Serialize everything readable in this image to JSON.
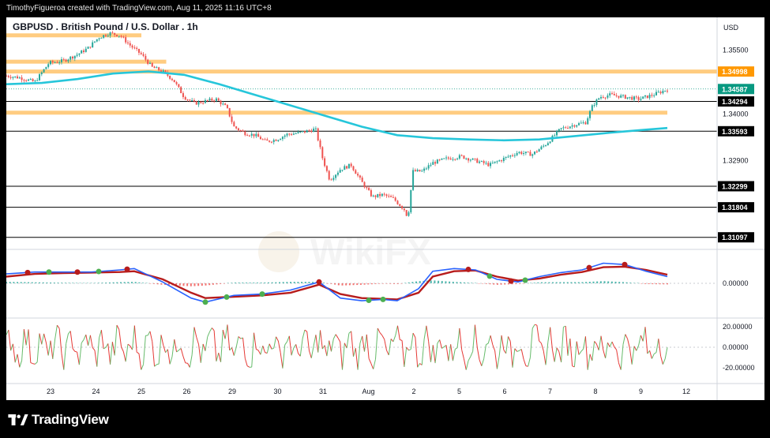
{
  "header": {
    "byline": "TimothyFigueroa created with TradingView.com, Aug 11, 2025 11:16 UTC+8"
  },
  "footer": {
    "brand": "TradingView"
  },
  "watermark": {
    "text": "WikiFX"
  },
  "colors": {
    "up": "#26a69a",
    "down": "#ef5350",
    "ema": "#26c6da",
    "zone": "#ffcc80",
    "resistance_tag": "#ff9800",
    "price_tag": "#089981",
    "level_tag": "#000000",
    "macd_fast": "#2962ff",
    "macd_slow": "#b71c1c",
    "macd_signal_green": "#4caf50",
    "osc_up": "#66bb6a",
    "osc_down": "#e53935"
  },
  "chart_data": {
    "type": "candlestick",
    "title": "GBPUSD . British Pound / U.S. Dollar . 1h",
    "currency": "USD",
    "x_labels": [
      "23",
      "24",
      "25",
      "26",
      "29",
      "30",
      "31",
      "Aug",
      "2",
      "5",
      "6",
      "7",
      "8",
      "9",
      "12"
    ],
    "y_ticks": [
      "1.35500",
      "1.34000",
      "1.32900"
    ],
    "ylim": [
      1.3085,
      1.3605
    ],
    "price_tags": [
      {
        "label": "1.34998",
        "value": 1.34998,
        "style": "resistance"
      },
      {
        "label": "1.34587",
        "value": 1.34587,
        "style": "current"
      },
      {
        "label": "1.34294",
        "value": 1.34294,
        "style": "level"
      },
      {
        "label": "1.33593",
        "value": 1.33593,
        "style": "level"
      },
      {
        "label": "1.32299",
        "value": 1.32299,
        "style": "level"
      },
      {
        "label": "1.31804",
        "value": 1.31804,
        "style": "level"
      },
      {
        "label": "1.31097",
        "value": 1.31097,
        "style": "level"
      }
    ],
    "zones": [
      {
        "value": 1.3585,
        "x_start": 0.0,
        "x_end": 0.19
      },
      {
        "value": 1.3523,
        "x_start": 0.0,
        "x_end": 0.225
      },
      {
        "value": 1.34998,
        "x_start": 0.0,
        "x_end": 1.0
      },
      {
        "value": 1.3403,
        "x_start": 0.0,
        "x_end": 0.93
      }
    ],
    "price_path": [
      [
        0.0,
        1.349
      ],
      [
        0.02,
        1.3485
      ],
      [
        0.04,
        1.3475
      ],
      [
        0.06,
        1.352
      ],
      [
        0.08,
        1.3525
      ],
      [
        0.1,
        1.354
      ],
      [
        0.115,
        1.3555
      ],
      [
        0.13,
        1.358
      ],
      [
        0.145,
        1.359
      ],
      [
        0.16,
        1.3585
      ],
      [
        0.175,
        1.356
      ],
      [
        0.19,
        1.354
      ],
      [
        0.205,
        1.351
      ],
      [
        0.22,
        1.35
      ],
      [
        0.235,
        1.348
      ],
      [
        0.25,
        1.344
      ],
      [
        0.265,
        1.3425
      ],
      [
        0.28,
        1.343
      ],
      [
        0.295,
        1.3435
      ],
      [
        0.31,
        1.3415
      ],
      [
        0.32,
        1.337
      ],
      [
        0.335,
        1.3355
      ],
      [
        0.35,
        1.335
      ],
      [
        0.365,
        1.3335
      ],
      [
        0.38,
        1.334
      ],
      [
        0.395,
        1.3352
      ],
      [
        0.41,
        1.3355
      ],
      [
        0.425,
        1.336
      ],
      [
        0.435,
        1.3365
      ],
      [
        0.445,
        1.3295
      ],
      [
        0.455,
        1.3245
      ],
      [
        0.47,
        1.327
      ],
      [
        0.485,
        1.328
      ],
      [
        0.5,
        1.324
      ],
      [
        0.515,
        1.3205
      ],
      [
        0.53,
        1.321
      ],
      [
        0.545,
        1.32
      ],
      [
        0.56,
        1.3175
      ],
      [
        0.565,
        1.3155
      ],
      [
        0.572,
        1.3265
      ],
      [
        0.585,
        1.3265
      ],
      [
        0.6,
        1.3285
      ],
      [
        0.62,
        1.3295
      ],
      [
        0.64,
        1.33
      ],
      [
        0.66,
        1.329
      ],
      [
        0.68,
        1.328
      ],
      [
        0.7,
        1.3295
      ],
      [
        0.72,
        1.331
      ],
      [
        0.74,
        1.3305
      ],
      [
        0.76,
        1.333
      ],
      [
        0.78,
        1.3365
      ],
      [
        0.8,
        1.3375
      ],
      [
        0.815,
        1.338
      ],
      [
        0.825,
        1.342
      ],
      [
        0.835,
        1.344
      ],
      [
        0.85,
        1.3445
      ],
      [
        0.87,
        1.344
      ],
      [
        0.89,
        1.3435
      ],
      [
        0.91,
        1.3445
      ],
      [
        0.93,
        1.3458
      ]
    ],
    "ema_path": [
      [
        0.0,
        1.347
      ],
      [
        0.05,
        1.3473
      ],
      [
        0.1,
        1.3482
      ],
      [
        0.15,
        1.3495
      ],
      [
        0.2,
        1.35
      ],
      [
        0.25,
        1.3492
      ],
      [
        0.3,
        1.347
      ],
      [
        0.35,
        1.3445
      ],
      [
        0.4,
        1.342
      ],
      [
        0.45,
        1.3395
      ],
      [
        0.5,
        1.337
      ],
      [
        0.55,
        1.335
      ],
      [
        0.6,
        1.3343
      ],
      [
        0.65,
        1.334
      ],
      [
        0.7,
        1.3338
      ],
      [
        0.75,
        1.334
      ],
      [
        0.8,
        1.3348
      ],
      [
        0.85,
        1.3356
      ],
      [
        0.9,
        1.3363
      ],
      [
        0.93,
        1.3367
      ]
    ],
    "macd": {
      "zero_label": "0.00000",
      "fast": [
        [
          0.0,
          0.35
        ],
        [
          0.04,
          0.42
        ],
        [
          0.08,
          0.42
        ],
        [
          0.12,
          0.42
        ],
        [
          0.16,
          0.5
        ],
        [
          0.18,
          0.55
        ],
        [
          0.22,
          0.05
        ],
        [
          0.26,
          -0.55
        ],
        [
          0.28,
          -0.7
        ],
        [
          0.32,
          -0.45
        ],
        [
          0.36,
          -0.4
        ],
        [
          0.4,
          -0.25
        ],
        [
          0.44,
          0.05
        ],
        [
          0.47,
          -0.55
        ],
        [
          0.5,
          -0.65
        ],
        [
          0.53,
          -0.6
        ],
        [
          0.55,
          -0.65
        ],
        [
          0.58,
          -0.2
        ],
        [
          0.6,
          0.45
        ],
        [
          0.63,
          0.55
        ],
        [
          0.66,
          0.5
        ],
        [
          0.69,
          0.15
        ],
        [
          0.72,
          0.05
        ],
        [
          0.75,
          0.25
        ],
        [
          0.78,
          0.4
        ],
        [
          0.81,
          0.5
        ],
        [
          0.84,
          0.75
        ],
        [
          0.87,
          0.7
        ],
        [
          0.9,
          0.45
        ],
        [
          0.93,
          0.25
        ]
      ],
      "slow": [
        [
          0.0,
          0.25
        ],
        [
          0.04,
          0.35
        ],
        [
          0.08,
          0.38
        ],
        [
          0.12,
          0.4
        ],
        [
          0.16,
          0.42
        ],
        [
          0.18,
          0.45
        ],
        [
          0.22,
          0.15
        ],
        [
          0.26,
          -0.35
        ],
        [
          0.28,
          -0.55
        ],
        [
          0.32,
          -0.5
        ],
        [
          0.36,
          -0.45
        ],
        [
          0.4,
          -0.35
        ],
        [
          0.44,
          -0.05
        ],
        [
          0.47,
          -0.4
        ],
        [
          0.5,
          -0.55
        ],
        [
          0.53,
          -0.58
        ],
        [
          0.55,
          -0.6
        ],
        [
          0.58,
          -0.35
        ],
        [
          0.6,
          0.25
        ],
        [
          0.63,
          0.45
        ],
        [
          0.66,
          0.48
        ],
        [
          0.69,
          0.25
        ],
        [
          0.72,
          0.1
        ],
        [
          0.75,
          0.18
        ],
        [
          0.78,
          0.32
        ],
        [
          0.81,
          0.42
        ],
        [
          0.84,
          0.6
        ],
        [
          0.87,
          0.62
        ],
        [
          0.9,
          0.5
        ],
        [
          0.93,
          0.32
        ]
      ],
      "dots_red": [
        0.03,
        0.1,
        0.17,
        0.44,
        0.65,
        0.71,
        0.82,
        0.87
      ],
      "dots_green": [
        0.06,
        0.13,
        0.28,
        0.31,
        0.36,
        0.51,
        0.53,
        0.68,
        0.73
      ]
    },
    "oscillator": {
      "ticks": [
        "20.00000",
        "0.00000",
        "-20.00000"
      ],
      "ylim": [
        -30,
        30
      ]
    }
  }
}
